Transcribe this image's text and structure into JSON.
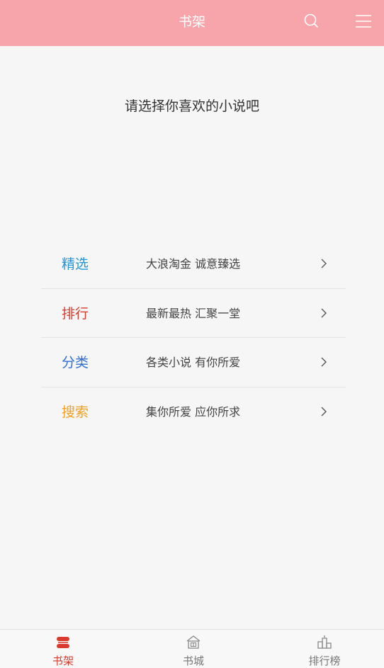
{
  "header": {
    "title": "书架",
    "search_icon": "search-icon",
    "menu_icon": "hamburger-menu-icon",
    "background": "#f7a5ab"
  },
  "prompt": "请选择你喜欢的小说吧",
  "menu": [
    {
      "label": "精选",
      "desc": "大浪淘金  诚意臻选",
      "color": "#2196d6"
    },
    {
      "label": "排行",
      "desc": "最新最热  汇聚一堂",
      "color": "#d93a2b"
    },
    {
      "label": "分类",
      "desc": "各类小说  有你所爱",
      "color": "#2f6fd0"
    },
    {
      "label": "搜索",
      "desc": "集你所爱  应你所求",
      "color": "#f0a020"
    }
  ],
  "tabs": [
    {
      "label": "书架",
      "icon": "bookshelf-icon",
      "active": true
    },
    {
      "label": "书城",
      "icon": "bookstore-icon",
      "active": false
    },
    {
      "label": "排行榜",
      "icon": "ranking-icon",
      "active": false
    }
  ],
  "colors": {
    "tab_active": "#d93a2b",
    "tab_inactive": "#777777"
  }
}
